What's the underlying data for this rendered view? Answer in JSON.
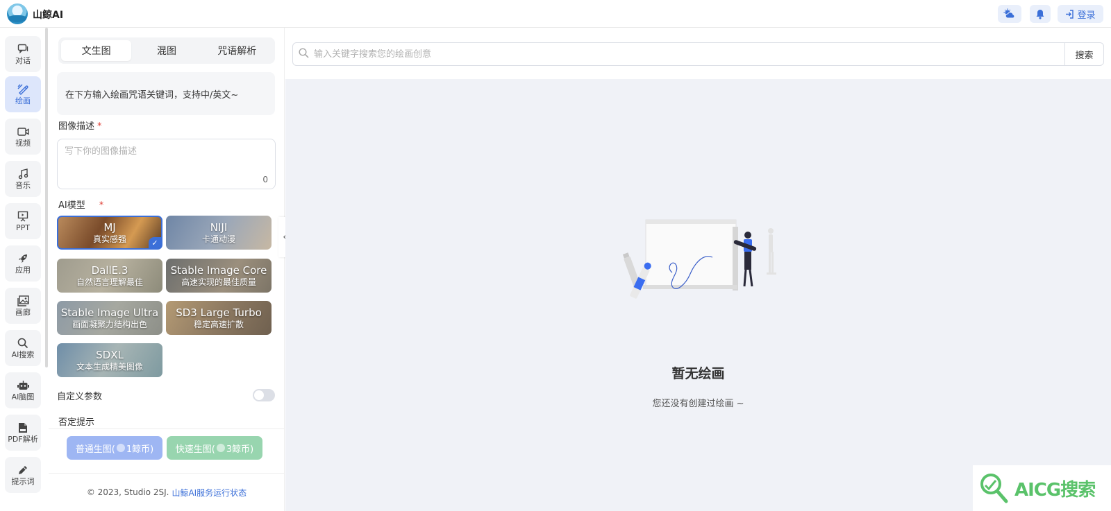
{
  "app": {
    "name": "山鲸AI"
  },
  "header": {
    "login_label": "登录"
  },
  "rail": {
    "items": [
      {
        "label": "对话",
        "icon": "chat-icon",
        "active": false
      },
      {
        "label": "绘画",
        "icon": "brush-icon",
        "active": true
      },
      {
        "label": "视频",
        "icon": "video-icon",
        "active": false
      },
      {
        "label": "音乐",
        "icon": "music-icon",
        "active": false
      },
      {
        "label": "PPT",
        "icon": "presentation-icon",
        "active": false
      },
      {
        "label": "应用",
        "icon": "rocket-icon",
        "active": false
      },
      {
        "label": "画廊",
        "icon": "gallery-icon",
        "active": false
      },
      {
        "label": "AI搜索",
        "icon": "search-icon",
        "active": false
      },
      {
        "label": "AI脑图",
        "icon": "robot-icon",
        "active": false
      },
      {
        "label": "PDF解析",
        "icon": "pdf-icon",
        "active": false
      },
      {
        "label": "提示词",
        "icon": "pen-icon",
        "active": false
      }
    ]
  },
  "panel": {
    "tabs": [
      "文生图",
      "混图",
      "咒语解析"
    ],
    "active_tab": "文生图",
    "hint": "在下方输入绘画咒语关键词，支持中/英文~",
    "description_label": "图像描述",
    "description_placeholder": "写下你的图像描述",
    "description_count": "0",
    "model_label": "AI模型",
    "models": [
      {
        "name": "MJ",
        "desc": "真实感强",
        "selected": true
      },
      {
        "name": "NIJI",
        "desc": "卡通动漫",
        "selected": false
      },
      {
        "name": "DallE.3",
        "desc": "自然语言理解最佳",
        "selected": false
      },
      {
        "name": "Stable Image Core",
        "desc": "高速实现的最佳质量",
        "selected": false
      },
      {
        "name": "Stable Image Ultra",
        "desc": "画面凝聚力结构出色",
        "selected": false
      },
      {
        "name": "SD3 Large Turbo",
        "desc": "稳定高速扩散",
        "selected": false
      },
      {
        "name": "SDXL",
        "desc": "文本生成精美图像",
        "selected": false
      }
    ],
    "custom_params_label": "自定义参数",
    "custom_params_on": false,
    "negative_prompt_label": "否定提示",
    "generate_normal": {
      "prefix": "普通生图(",
      "cost": "1鲸币)"
    },
    "generate_fast": {
      "prefix": "快速生图(",
      "cost": "3鲸币)"
    },
    "footer_text": "© 2023, Studio 2SJ.",
    "footer_link": "山鲸AI服务运行状态"
  },
  "main": {
    "search_placeholder": "输入关键字搜索您的绘画创意",
    "search_button": "搜索",
    "empty_title": "暂无绘画",
    "empty_subtitle": "您还没有创建过绘画 ~"
  },
  "watermark": {
    "text": "AICG搜索"
  },
  "colors": {
    "accent": "#3b6fd8",
    "canvas_bg": "#f0f2f7",
    "fast_button": "#98d5af",
    "normal_button": "#9eb6f3"
  }
}
